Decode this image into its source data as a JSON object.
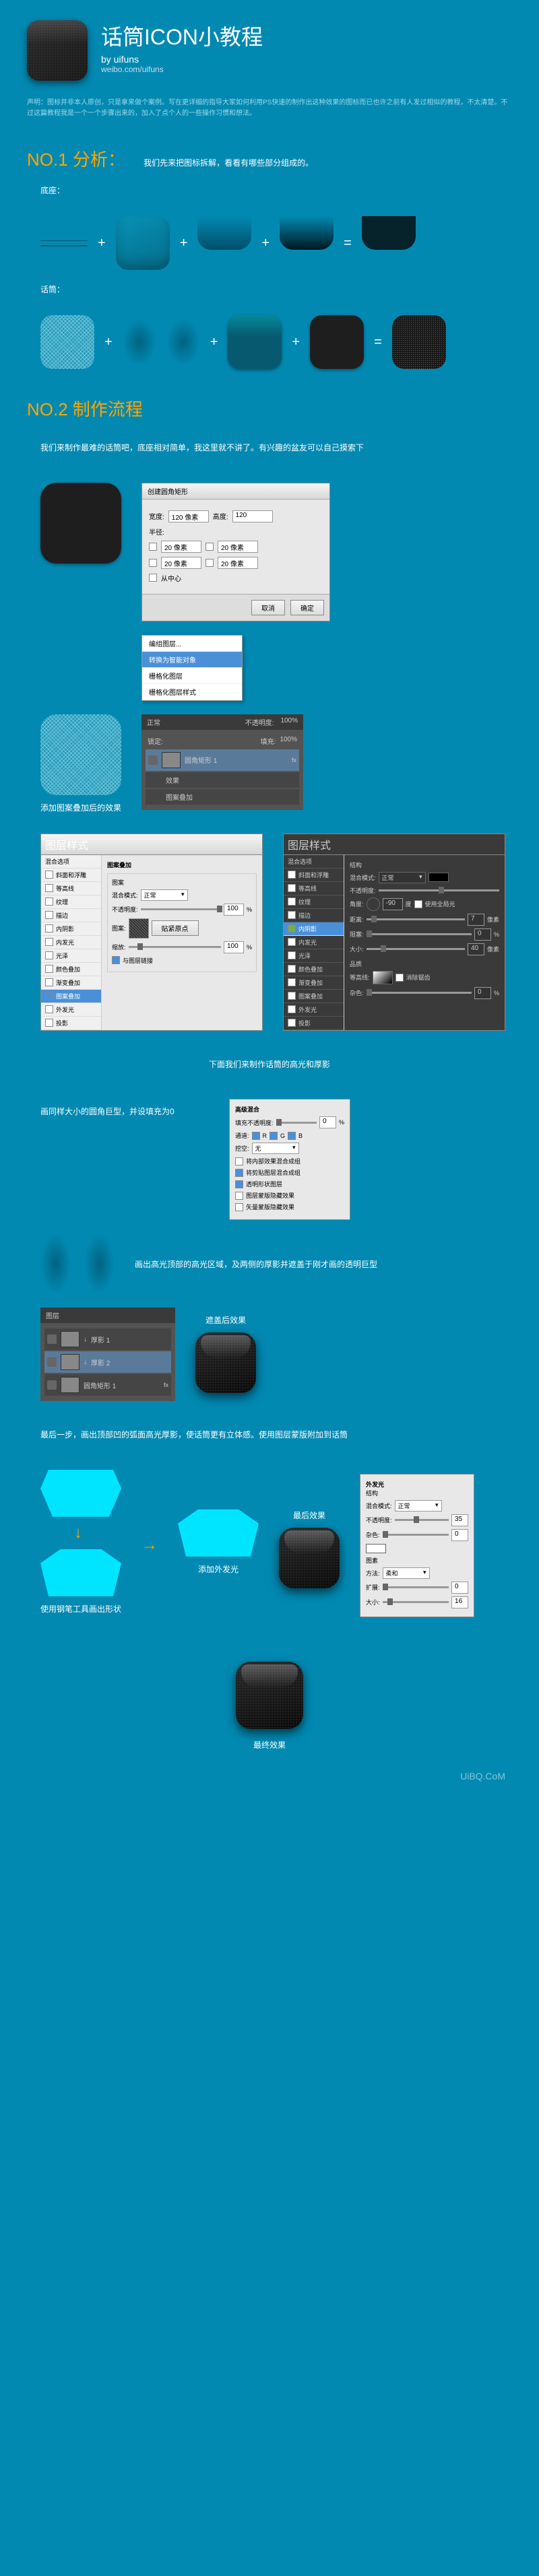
{
  "header": {
    "title": "话筒ICON小教程",
    "byline": "by uifuns",
    "weibo": "weibo.com/uifuns"
  },
  "disclaimer": "声明：图标并非本人原创，只是拿来做个案例。写在更详细的指导大家如何利用PS快速的制作出这种效果的图标而已也许之前有人发过相似的教程，不太清楚。不过这篇教程我是一个一个步骤出来的，加入了点个人的一些操作习惯和想法。",
  "section1": {
    "title": "NO.1  分析：",
    "desc": "我们先来把图标拆解，看看有哪些部分组成的。",
    "label_base": "底座：",
    "label_speaker": "话筒："
  },
  "section2": {
    "title": "NO.2 制作流程",
    "desc1": "我们来制作最难的话筒吧，底座相对简单，我这里就不讲了。有兴趣的盆友可以自己摸索下",
    "caption_pattern": "添加图案叠加后的效果",
    "desc_highlight": "下面我们来制作话筒的高光和厚影",
    "desc_same_size": "画同样大小的圆角巨型，并设填充为0",
    "desc_shading": "画出高光顶部的高光区域，及两侧的厚影并遮盖于刚才画的透明巨型",
    "caption_shading": "遮盖后效果",
    "desc_final": "最后一步，画出顶部凹的弧面高光厚影，使话筒更有立体感。使用图层蒙版附加到话筒",
    "caption_final_effect": "最后效果",
    "caption_pen": "使用钢笔工具画出形状",
    "caption_glow": "添加外发光",
    "caption_final": "最终效果"
  },
  "rounded_rect_dialog": {
    "title": "创建圆角矩形",
    "width_label": "宽度:",
    "width_value": "120 像素",
    "height_label": "高度:",
    "height_value": "120",
    "radius_label": "半径:",
    "r1": "20 像素",
    "r2": "20 像素",
    "r3": "20 像素",
    "r4": "20 像素",
    "from_center": "从中心",
    "cancel": "取消",
    "ok": "确定"
  },
  "context_menu": {
    "item1": "编组图层...",
    "item2": "转换为智能对象",
    "item3": "栅格化图层",
    "item4": "栅格化图层样式"
  },
  "layers_panel": {
    "tab1": "正常",
    "tab2": "图层",
    "opacity_label": "不透明度:",
    "opacity_value": "100%",
    "lock": "锁定:",
    "fill_label": "填充:",
    "fill_value": "100%",
    "layer1": "圆角矩形 1",
    "layer_effects": "效果",
    "layer_pattern": "图案叠加",
    "fx": "fx"
  },
  "layer_style": {
    "title": "图层样式",
    "sidebar": {
      "blend": "混合选项",
      "bevel": "斜面和浮雕",
      "contour": "等高线",
      "texture": "纹理",
      "stroke": "描边",
      "inner_shadow": "内阴影",
      "inner_glow": "内发光",
      "satin": "光泽",
      "color_overlay": "颜色叠加",
      "gradient_overlay": "渐变叠加",
      "pattern_overlay": "图案叠加",
      "outer_glow": "外发光",
      "drop_shadow": "投影"
    },
    "pattern_section": "图案叠加",
    "pattern_label": "图案",
    "blend_mode": "混合模式:",
    "blend_normal": "正常",
    "opacity": "不透明度:",
    "opacity_100": "100",
    "pattern_field": "图案:",
    "scale": "缩放:",
    "scale_100": "100",
    "percent": "%",
    "link_layer": "与图层链接",
    "snap": "贴紧原点"
  },
  "layer_style_dark": {
    "struct": "结构",
    "blend_mode_label": "混合模式:",
    "normal": "正常",
    "opacity_label": "不透明度:",
    "angle_label": "角度:",
    "angle_val": "-90",
    "degree": "度",
    "global_light": "使用全局光",
    "distance": "距离:",
    "distance_val": "7",
    "px": "像素",
    "choke": "阻塞:",
    "choke_val": "0",
    "size_label": "大小:",
    "size_val": "40",
    "quality": "品质",
    "contour": "等高线:",
    "anti_alias": "消除锯齿",
    "noise": "杂色:",
    "noise_val": "0"
  },
  "advanced_blend": {
    "title": "高级混合",
    "fill_opacity": "填充不透明度:",
    "fill_val": "0",
    "channels": "通道:",
    "r": "R",
    "g": "G",
    "b": "B",
    "knockout": "挖空:",
    "knockout_none": "无",
    "opt1": "将内部效果混合成组",
    "opt2": "将剪贴图层混合成组",
    "opt3": "透明形状图层",
    "opt4": "图层蒙版隐藏效果",
    "opt5": "矢量蒙版隐藏效果"
  },
  "shading_layers": {
    "tab": "图层",
    "layer1": "厚影 1",
    "layer2": "厚影 2",
    "layer3": "圆角矩形 1"
  },
  "outer_glow": {
    "title": "外发光",
    "struct": "结构",
    "blend_mode": "混合模式:",
    "normal": "正常",
    "opacity": "不透明度:",
    "opacity_val": "35",
    "noise": "杂色:",
    "noise_val": "0",
    "elements": "图素",
    "method": "方法:",
    "softer": "柔和",
    "spread": "扩展:",
    "spread_val": "0",
    "size": "大小:",
    "size_val": "16"
  },
  "watermark": "UiBQ.CoM",
  "symbols": {
    "plus": "+",
    "equals": "="
  }
}
